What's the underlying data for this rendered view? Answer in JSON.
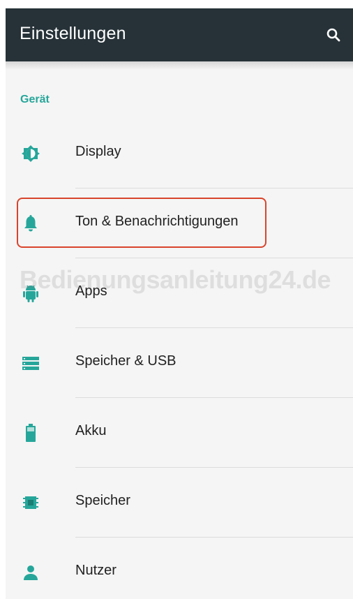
{
  "toolbar": {
    "title": "Einstellungen",
    "search_icon": "search-icon"
  },
  "section": {
    "header": "Gerät"
  },
  "items": [
    {
      "label": "Display",
      "icon": "brightness-icon"
    },
    {
      "label": "Ton & Benachrichtigungen",
      "icon": "bell-icon"
    },
    {
      "label": "Apps",
      "icon": "android-icon"
    },
    {
      "label": "Speicher & USB",
      "icon": "storage-icon"
    },
    {
      "label": "Akku",
      "icon": "battery-icon"
    },
    {
      "label": "Speicher",
      "icon": "memory-icon"
    },
    {
      "label": "Nutzer",
      "icon": "person-icon"
    }
  ],
  "watermark": "Bedienungsanleitung24.de",
  "colors": {
    "toolbar": "#263238",
    "accent": "#26a69a",
    "highlight": "#d9442c"
  }
}
